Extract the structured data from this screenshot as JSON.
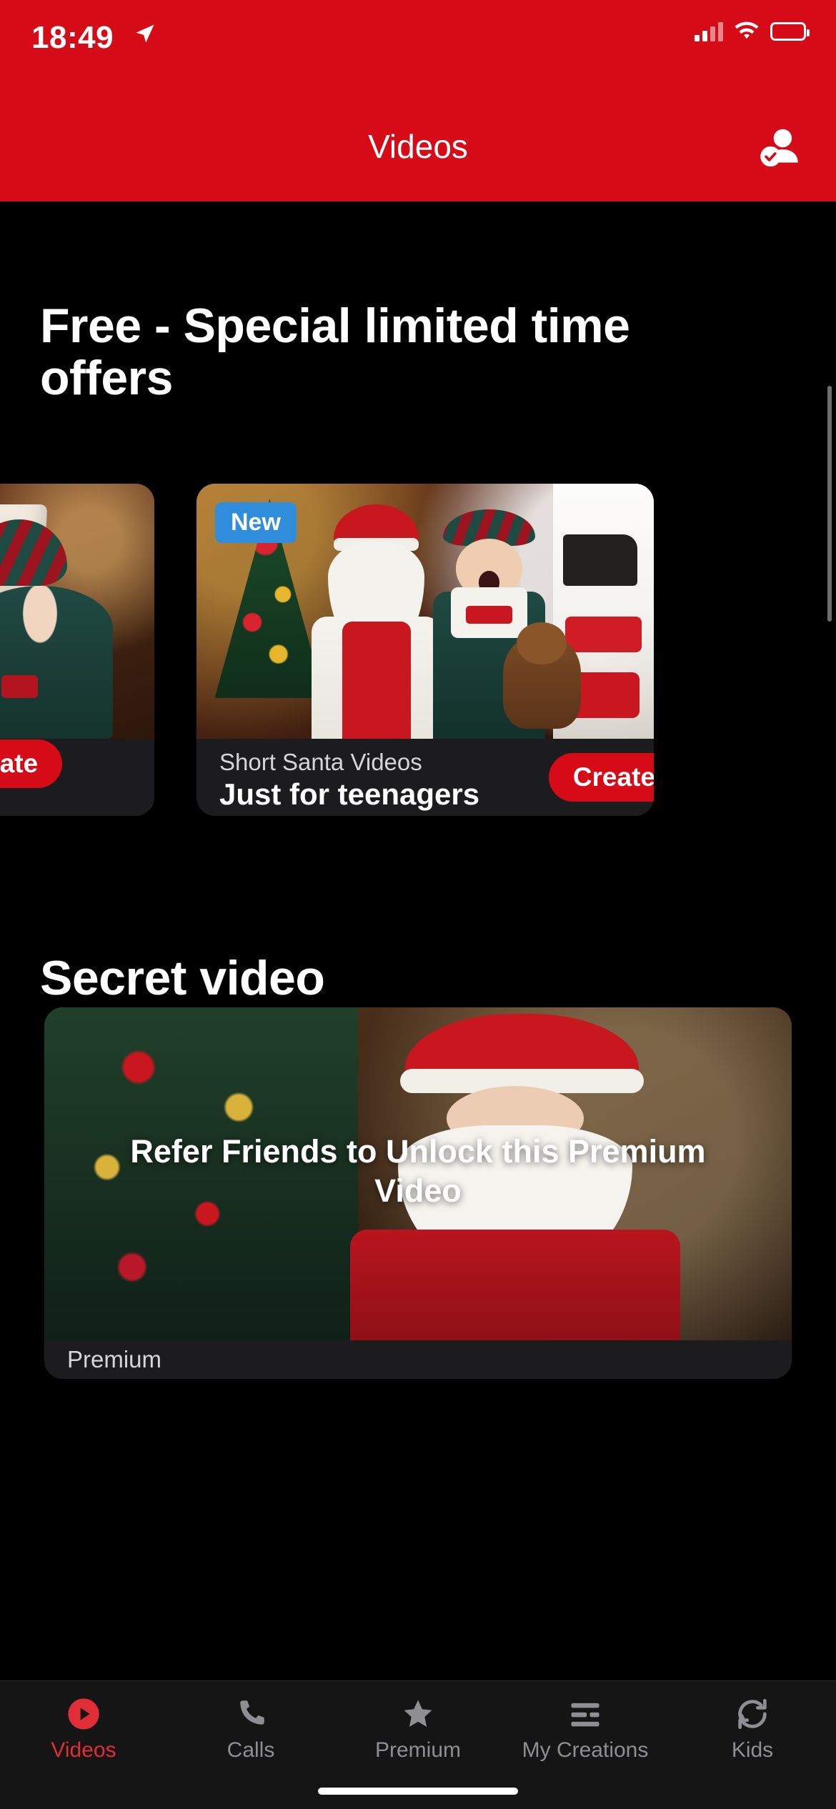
{
  "status_bar": {
    "time": "18:49",
    "location_icon": "location-arrow-icon",
    "signal_icon": "cellular-signal-icon",
    "wifi_icon": "wifi-icon",
    "battery_icon": "battery-icon"
  },
  "nav": {
    "title": "Videos",
    "profile_icon": "profile-verified-icon"
  },
  "sections": {
    "free": {
      "title": "Free - Special limited time offers",
      "cards": [
        {
          "badge": "",
          "subtitle": "",
          "name": "",
          "button": "Create",
          "image_alt": "elf-girl-workshop-photo"
        },
        {
          "badge": "New",
          "subtitle": "Short Santa Videos",
          "name": "Just for teenagers",
          "button": "Create",
          "image_alt": "santa-and-elf-toy-shop-photo"
        }
      ]
    },
    "secret": {
      "title": "Secret video",
      "card": {
        "overlay_text": "Refer Friends to Unlock this Premium Video",
        "footer_label": "Premium",
        "image_alt": "santa-by-christmas-tree-photo"
      }
    }
  },
  "tabbar": {
    "items": [
      {
        "label": "Videos",
        "icon": "play-circle-icon",
        "active": true
      },
      {
        "label": "Calls",
        "icon": "phone-icon",
        "active": false
      },
      {
        "label": "Premium",
        "icon": "star-icon",
        "active": false
      },
      {
        "label": "My Creations",
        "icon": "list-layout-icon",
        "active": false
      },
      {
        "label": "Kids",
        "icon": "refresh-circle-icon",
        "active": false
      }
    ]
  },
  "colors": {
    "brand_red": "#d50c18",
    "accent_blue": "#2f8ddb",
    "card_bg": "#1c1c1e",
    "tab_inactive": "#8e8e93",
    "tab_active": "#e02d38"
  }
}
